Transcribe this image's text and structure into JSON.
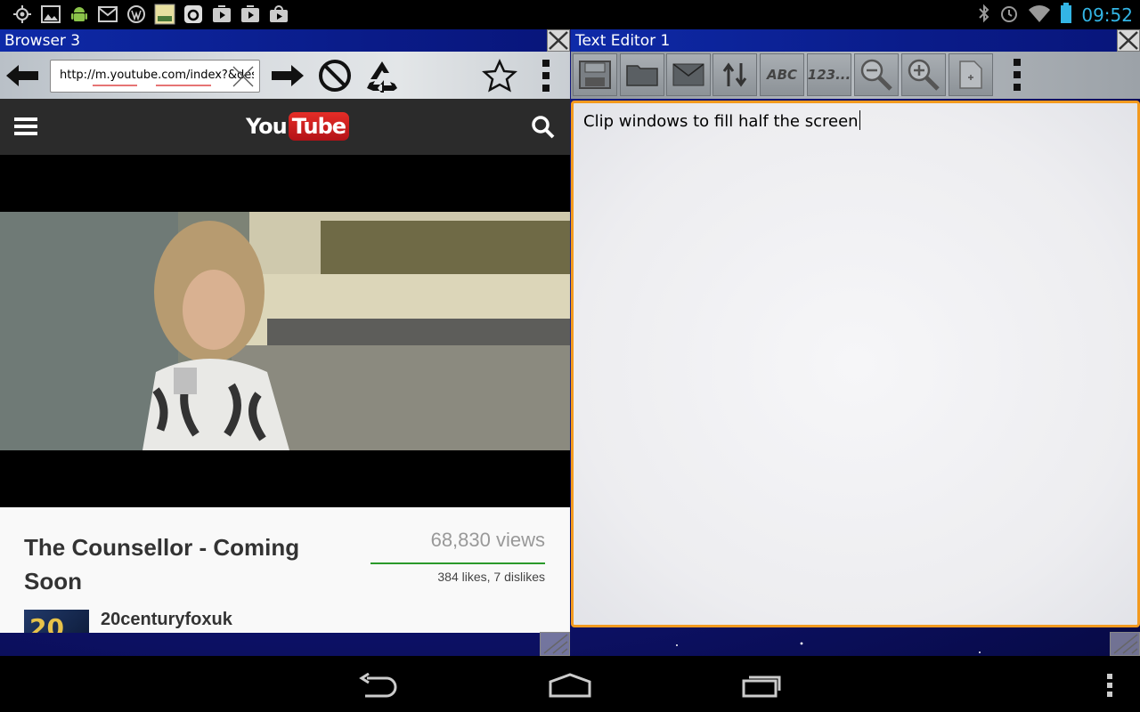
{
  "status_bar": {
    "time": "09:52",
    "left_icons": [
      "gps-icon",
      "image-icon",
      "android-icon",
      "gmail-icon",
      "wordpress-icon",
      "basic4android-icon",
      "app-icon",
      "play-icon",
      "play-icon",
      "shop-icon"
    ],
    "right_icons": [
      "bluetooth-icon",
      "alarm-icon",
      "wifi-icon",
      "battery-icon"
    ],
    "accent": "#33b5e5"
  },
  "browser": {
    "title": "Browser 3",
    "url": "http://m.youtube.com/index?&desktop",
    "page": {
      "logo_you": "You",
      "logo_tube": "Tube",
      "video_title": "The Counsellor - Coming Soon",
      "views": "68,830 views",
      "likes": "384 likes, 7 dislikes",
      "channel": "20centuryfoxuk"
    }
  },
  "editor": {
    "title": "Text Editor 1",
    "toolbar": {
      "spellcheck_label": "ABC",
      "numbers_label": "123..."
    },
    "content": "Clip windows to fill half the screen",
    "border_color": "#f39a1f"
  }
}
